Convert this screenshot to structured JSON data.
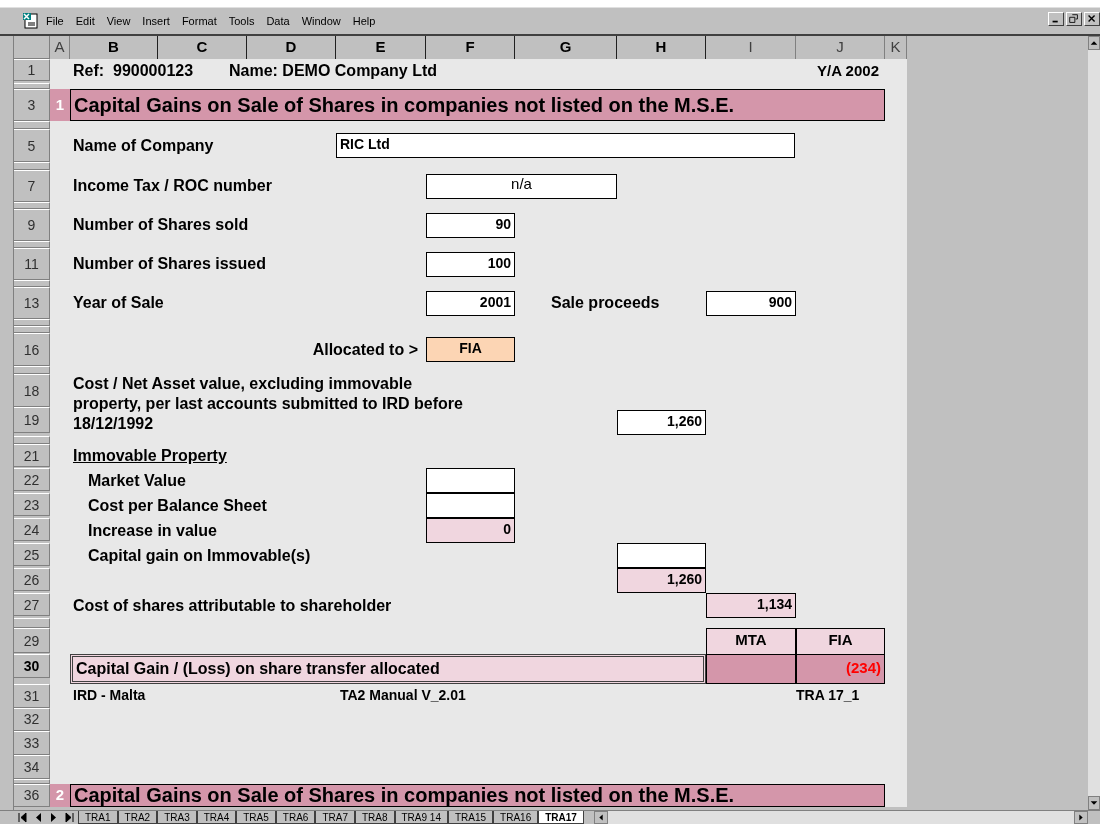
{
  "menu": [
    "File",
    "Edit",
    "View",
    "Insert",
    "Format",
    "Tools",
    "Data",
    "Window",
    "Help"
  ],
  "columns": [
    {
      "label": "A",
      "selected": false
    },
    {
      "label": "B",
      "selected": true
    },
    {
      "label": "C",
      "selected": true
    },
    {
      "label": "D",
      "selected": true
    },
    {
      "label": "E",
      "selected": true
    },
    {
      "label": "F",
      "selected": true
    },
    {
      "label": "G",
      "selected": true
    },
    {
      "label": "H",
      "selected": true
    },
    {
      "label": "I",
      "selected": false
    },
    {
      "label": "J",
      "selected": false
    },
    {
      "label": "K",
      "selected": false
    }
  ],
  "row_headers": [
    {
      "label": "1",
      "selected": false
    },
    {
      "label": "3",
      "selected": false
    },
    {
      "label": "5",
      "selected": false
    },
    {
      "label": "7",
      "selected": false
    },
    {
      "label": "9",
      "selected": false
    },
    {
      "label": "11",
      "selected": false
    },
    {
      "label": "13",
      "selected": false
    },
    {
      "label": "16",
      "selected": false
    },
    {
      "label": "18",
      "selected": false
    },
    {
      "label": "19",
      "selected": false
    },
    {
      "label": "21",
      "selected": false
    },
    {
      "label": "22",
      "selected": false
    },
    {
      "label": "23",
      "selected": false
    },
    {
      "label": "24",
      "selected": false
    },
    {
      "label": "25",
      "selected": false
    },
    {
      "label": "26",
      "selected": false
    },
    {
      "label": "27",
      "selected": false
    },
    {
      "label": "29",
      "selected": false
    },
    {
      "label": "30",
      "selected": true
    },
    {
      "label": "31",
      "selected": false
    },
    {
      "label": "32",
      "selected": false
    },
    {
      "label": "33",
      "selected": false
    },
    {
      "label": "34",
      "selected": false
    },
    {
      "label": "36",
      "selected": false
    }
  ],
  "header": {
    "ref": "Ref:  990000123",
    "name": "Name: DEMO Company Ltd",
    "year": "Y/A 2002"
  },
  "sections": [
    {
      "number": "1",
      "title": "Capital Gains on Sale of Shares in companies not listed on the M.S.E."
    },
    {
      "number": "2",
      "title": "Capital Gains on Sale of Shares in companies not listed on the M.S.E."
    }
  ],
  "fields": [
    {
      "label": "Name of Company",
      "value": "RIC Ltd"
    },
    {
      "label": "Income Tax / ROC number",
      "value": "n/a"
    },
    {
      "label": "Number of Shares sold",
      "value": "90"
    },
    {
      "label": "Number of Shares issued",
      "value": "100"
    },
    {
      "label": "Year of Sale",
      "value": "2001"
    },
    {
      "label": "Sale proceeds",
      "value": "900"
    },
    {
      "label": "Allocated to >",
      "value": "FIA"
    },
    {
      "label": "Cost / Net Asset value, excluding immovable property, per last accounts submitted to IRD before 18/12/1992",
      "value": "1,260"
    }
  ],
  "immovable": {
    "heading": "Immovable Property",
    "rows": [
      {
        "label": "Market Value",
        "kind": "input"
      },
      {
        "label": "Cost per Balance Sheet",
        "kind": "input"
      },
      {
        "label": "Increase in value",
        "kind": "computed",
        "value": "0"
      },
      {
        "label": "Capital gain on Immovable(s)",
        "kind": "input"
      },
      {
        "kind": "computed",
        "value": "1,260"
      }
    ]
  },
  "cost_attributable": {
    "label": "Cost of shares attributable to shareholder",
    "value": "1,134"
  },
  "allocation": {
    "label": "Capital Gain / (Loss) on share transfer allocated",
    "cells": [
      {
        "header": "MTA"
      },
      {
        "header": "FIA",
        "value": "(234)",
        "negative": true
      }
    ]
  },
  "footer": {
    "left": "IRD - Malta",
    "center": "TA2 Manual V_2.01",
    "right": "TRA 17_1"
  },
  "sheet_tabs": [
    {
      "label": "TRA1",
      "selected": false
    },
    {
      "label": "TRA2",
      "selected": false
    },
    {
      "label": "TRA3",
      "selected": false
    },
    {
      "label": "TRA4",
      "selected": false
    },
    {
      "label": "TRA5",
      "selected": false
    },
    {
      "label": "TRA6",
      "selected": false
    },
    {
      "label": "TRA7",
      "selected": false
    },
    {
      "label": "TRA8",
      "selected": false
    },
    {
      "label": "TRA9 14",
      "selected": false
    },
    {
      "label": "TRA15",
      "selected": false
    },
    {
      "label": "TRA16",
      "selected": false
    },
    {
      "label": "TRA17",
      "selected": true
    }
  ]
}
